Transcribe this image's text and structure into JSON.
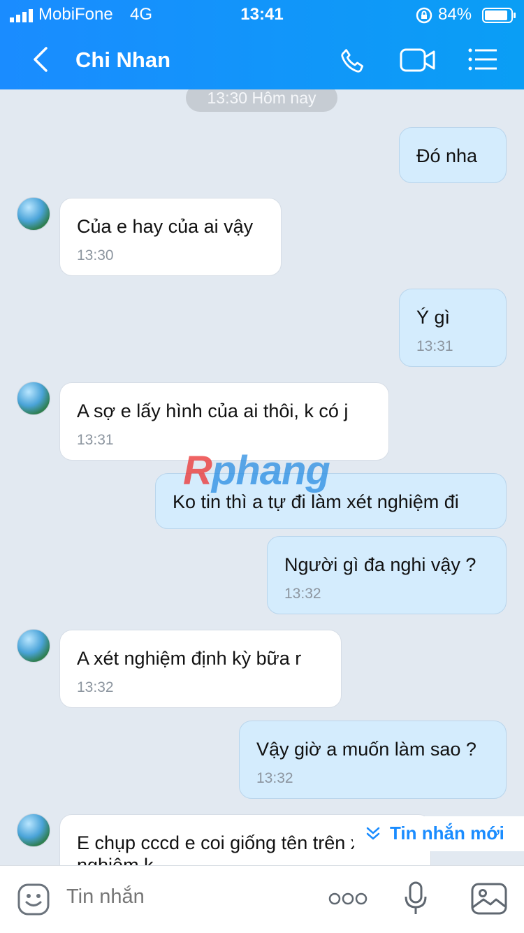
{
  "status_bar": {
    "carrier": "MobiFone",
    "network": "4G",
    "time": "13:41",
    "battery": "84%"
  },
  "header": {
    "contact_name": "Chi Nhan"
  },
  "conversation": {
    "date_separator": "13:30 Hôm nay",
    "messages": [
      {
        "dir": "out",
        "text": "Đó nha",
        "time": ""
      },
      {
        "dir": "in",
        "text": "Của e hay của ai vậy",
        "time": "13:30"
      },
      {
        "dir": "out",
        "text": "Ý gì",
        "time": "13:31"
      },
      {
        "dir": "in",
        "text": "A sợ e lấy hình của ai thôi, k có j",
        "time": "13:31"
      },
      {
        "dir": "out",
        "text": "Ko tin thì a tự đi làm xét nghiệm đi",
        "time": ""
      },
      {
        "dir": "out",
        "text": "Người gì đa nghi vậy ?",
        "time": "13:32"
      },
      {
        "dir": "in",
        "text": "A xét nghiệm định kỳ bữa r",
        "time": "13:32"
      },
      {
        "dir": "out",
        "text": "Vậy giờ a muốn làm sao ?",
        "time": "13:32"
      },
      {
        "dir": "in",
        "text": "E chụp cccd e coi giống tên trên xét",
        "text2": "nghiệm k",
        "time": ""
      }
    ]
  },
  "watermark": {
    "first": "R",
    "rest": "phang"
  },
  "new_message_banner": {
    "label": "Tin nhắn mới"
  },
  "composer": {
    "placeholder": "Tin nhắn"
  },
  "colors": {
    "header": "#1a8cff",
    "outgoing_bubble": "#d4ecfd",
    "incoming_bubble": "#ffffff",
    "background": "#e2e9f1"
  }
}
